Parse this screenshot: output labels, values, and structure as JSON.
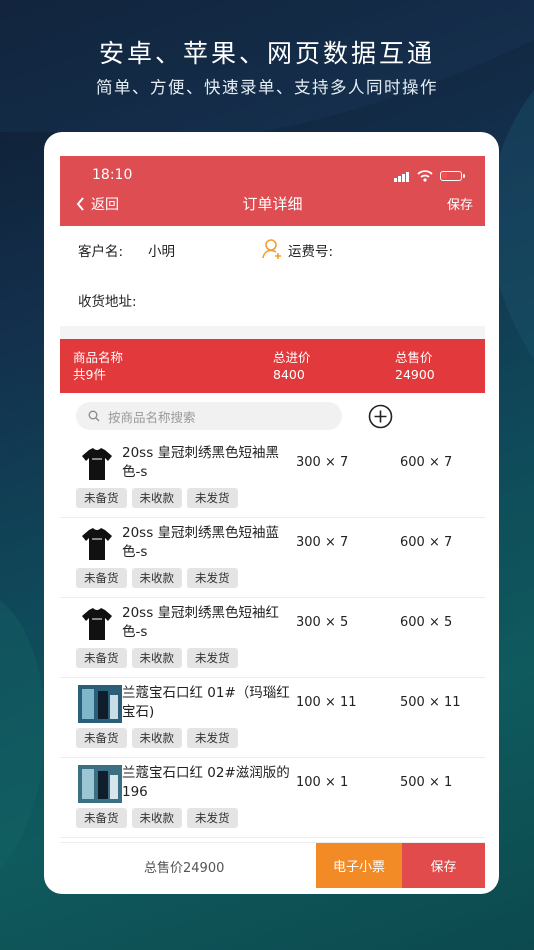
{
  "promo": {
    "headline": "安卓、苹果、网页数据互通",
    "subline": "简单、方便、快速录单、支持多人同时操作"
  },
  "status_bar": {
    "time": "18:10"
  },
  "nav": {
    "back_label": "返回",
    "title": "订单详细",
    "save_label": "保存"
  },
  "customer": {
    "name_label": "客户名:",
    "name_value": "小明",
    "fee_label": "运费号:",
    "address_label": "收货地址:"
  },
  "summary": {
    "name_header": "商品名称",
    "count": "共9件",
    "cost_header": "总进价",
    "cost_value": "8400",
    "sale_header": "总售价",
    "sale_value": "24900"
  },
  "search": {
    "placeholder": "按商品名称搜索"
  },
  "items": [
    {
      "name": "20ss 皇冠刺绣黑色短袖黑色-s",
      "cost": "300 × 7",
      "sale": "600 × 7",
      "thumb": "tshirt-icon",
      "tags": [
        "未备货",
        "未收款",
        "未发货"
      ]
    },
    {
      "name": "20ss 皇冠刺绣黑色短袖蓝色-s",
      "cost": "300 × 7",
      "sale": "600 × 7",
      "thumb": "tshirt-icon",
      "tags": [
        "未备货",
        "未收款",
        "未发货"
      ]
    },
    {
      "name": "20ss 皇冠刺绣黑色短袖红色-s",
      "cost": "300 × 5",
      "sale": "600 × 5",
      "thumb": "tshirt-icon",
      "tags": [
        "未备货",
        "未收款",
        "未发货"
      ]
    },
    {
      "name": "兰蔻宝石口红 01#（玛瑙红宝石)",
      "cost": "100 × 11",
      "sale": "500 × 11",
      "thumb": "lipstick-photo",
      "tags": [
        "未备货",
        "未收款",
        "未发货"
      ]
    },
    {
      "name": "兰蔻宝石口红 02#滋润版的196",
      "cost": "100 × 1",
      "sale": "500 × 1",
      "thumb": "lipstick-photo",
      "tags": [
        "未备货",
        "未收款",
        "未发货"
      ]
    }
  ],
  "footer": {
    "total": "总售价24900",
    "ticket_label": "电子小票",
    "save_label": "保存"
  },
  "colors": {
    "header_red": "#dd4d52",
    "summary_red": "#e23a3c",
    "ticket_orange": "#f28a25",
    "save_red": "#e24b4b",
    "person_icon_orange": "#f0a030"
  }
}
